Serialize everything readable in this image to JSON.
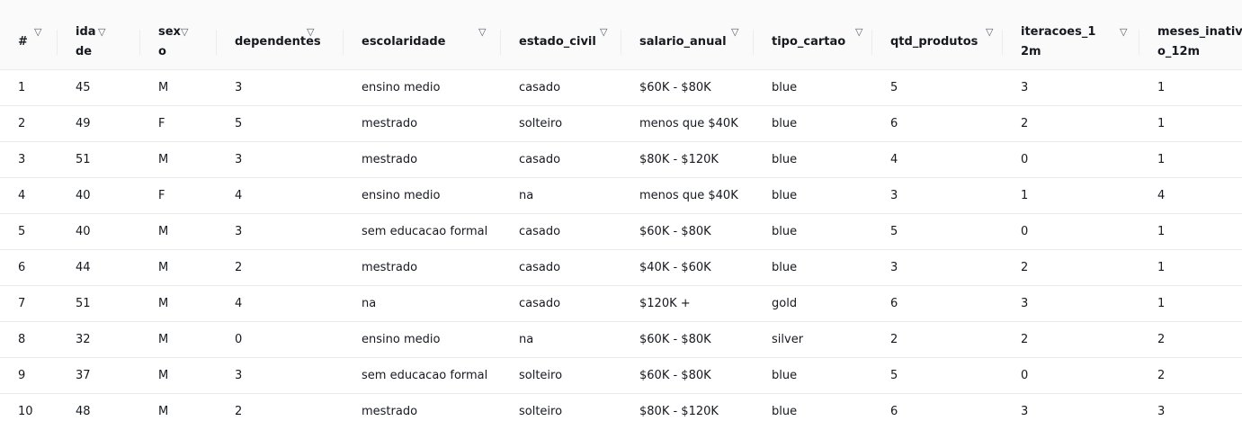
{
  "table": {
    "sort_icon": "sort-down-icon",
    "columns": [
      {
        "key": "idx",
        "label": "#",
        "name": "col-index"
      },
      {
        "key": "idade",
        "label": "idade",
        "name": "col-idade"
      },
      {
        "key": "sexo",
        "label": "sexo",
        "name": "col-sexo"
      },
      {
        "key": "dependentes",
        "label": "dependentes",
        "name": "col-dependentes"
      },
      {
        "key": "escolaridade",
        "label": "escolaridade",
        "name": "col-escolaridade"
      },
      {
        "key": "estado_civil",
        "label": "estado_civil",
        "name": "col-estado-civil"
      },
      {
        "key": "salario_anual",
        "label": "salario_anual",
        "name": "col-salario-anual"
      },
      {
        "key": "tipo_cartao",
        "label": "tipo_cartao",
        "name": "col-tipo-cartao"
      },
      {
        "key": "qtd_produtos",
        "label": "qtd_produtos",
        "name": "col-qtd-produtos"
      },
      {
        "key": "iteracoes_12m",
        "label": "iteracoes_12m",
        "name": "col-iteracoes-12m"
      },
      {
        "key": "meses_inativo_12m",
        "label": "meses_inativo_12m",
        "name": "col-meses-inativo-12m"
      }
    ],
    "rows": [
      [
        "1",
        "45",
        "M",
        "3",
        "ensino medio",
        "casado",
        "$60K - $80K",
        "blue",
        "5",
        "3",
        "1"
      ],
      [
        "2",
        "49",
        "F",
        "5",
        "mestrado",
        "solteiro",
        "menos que $40K",
        "blue",
        "6",
        "2",
        "1"
      ],
      [
        "3",
        "51",
        "M",
        "3",
        "mestrado",
        "casado",
        "$80K - $120K",
        "blue",
        "4",
        "0",
        "1"
      ],
      [
        "4",
        "40",
        "F",
        "4",
        "ensino medio",
        "na",
        "menos que $40K",
        "blue",
        "3",
        "1",
        "4"
      ],
      [
        "5",
        "40",
        "M",
        "3",
        "sem educacao formal",
        "casado",
        "$60K - $80K",
        "blue",
        "5",
        "0",
        "1"
      ],
      [
        "6",
        "44",
        "M",
        "2",
        "mestrado",
        "casado",
        "$40K - $60K",
        "blue",
        "3",
        "2",
        "1"
      ],
      [
        "7",
        "51",
        "M",
        "4",
        "na",
        "casado",
        "$120K +",
        "gold",
        "6",
        "3",
        "1"
      ],
      [
        "8",
        "32",
        "M",
        "0",
        "ensino medio",
        "na",
        "$60K - $80K",
        "silver",
        "2",
        "2",
        "2"
      ],
      [
        "9",
        "37",
        "M",
        "3",
        "sem educacao formal",
        "solteiro",
        "$60K - $80K",
        "blue",
        "5",
        "0",
        "2"
      ],
      [
        "10",
        "48",
        "M",
        "2",
        "mestrado",
        "solteiro",
        "$80K - $120K",
        "blue",
        "6",
        "3",
        "3"
      ]
    ]
  }
}
